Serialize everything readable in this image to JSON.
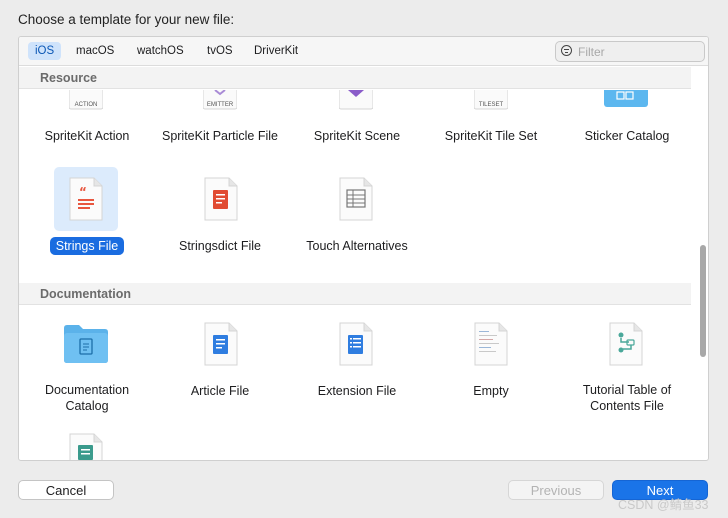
{
  "dialog": {
    "title": "Choose a template for your new file:"
  },
  "tabs": [
    {
      "label": "iOS",
      "active": true
    },
    {
      "label": "macOS"
    },
    {
      "label": "watchOS"
    },
    {
      "label": "tvOS"
    },
    {
      "label": "DriverKit"
    }
  ],
  "filter": {
    "placeholder": "Filter"
  },
  "sections": {
    "resource": {
      "header": "Resource",
      "row1": [
        {
          "label": "SpriteKit Action",
          "icon_text": "ACTION",
          "icon": "spritekit-action-icon"
        },
        {
          "label": "SpriteKit Particle File",
          "icon_text": "EMITTER",
          "icon": "spritekit-particle-icon"
        },
        {
          "label": "SpriteKit Scene",
          "icon": "spritekit-scene-icon"
        },
        {
          "label": "SpriteKit Tile Set",
          "icon_text": "TILESET",
          "icon": "spritekit-tileset-icon"
        },
        {
          "label": "Sticker Catalog",
          "icon": "sticker-catalog-icon"
        }
      ],
      "row2": [
        {
          "label": "Strings File",
          "icon": "strings-file-icon",
          "selected": true
        },
        {
          "label": "Stringsdict File",
          "icon": "stringsdict-file-icon"
        },
        {
          "label": "Touch Alternatives",
          "icon": "touch-alternatives-icon"
        }
      ]
    },
    "documentation": {
      "header": "Documentation",
      "row1": [
        {
          "label": "Documentation Catalog",
          "icon": "documentation-catalog-icon"
        },
        {
          "label": "Article File",
          "icon": "article-file-icon"
        },
        {
          "label": "Extension File",
          "icon": "extension-file-icon"
        },
        {
          "label": "Empty",
          "icon": "empty-file-icon"
        },
        {
          "label": "Tutorial Table of Contents File",
          "icon": "tutorial-toc-icon"
        }
      ]
    }
  },
  "buttons": {
    "cancel": "Cancel",
    "previous": "Previous",
    "next": "Next"
  },
  "watermark": "CSDN @鲭鱼33",
  "colors": {
    "accent": "#1a74e8",
    "selection": "#1a6ce0",
    "strings_icon": "#e8563f",
    "doc_blue": "#2f7de0"
  }
}
